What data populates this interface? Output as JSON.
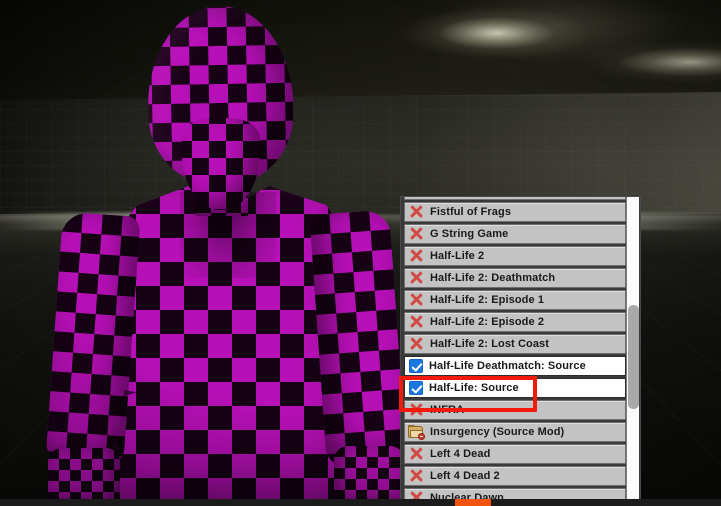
{
  "scene": {
    "description": "Source engine viewport showing a character model with missing textures (magenta/black checkerboard) in a dark room",
    "model_color_primary": "#b810b8",
    "model_color_secondary": "#170215",
    "room_color": "#2c2c26"
  },
  "list_panel": {
    "name": "mountable-games-list",
    "partial_top_row": true,
    "rows": [
      {
        "label": "Fistful of Frags",
        "status": "unavailable",
        "icon": "red-x-icon",
        "checked": false
      },
      {
        "label": "G String Game",
        "status": "unavailable",
        "icon": "red-x-icon",
        "checked": false
      },
      {
        "label": "Half-Life 2",
        "status": "unavailable",
        "icon": "red-x-icon",
        "checked": false
      },
      {
        "label": "Half-Life 2: Deathmatch",
        "status": "unavailable",
        "icon": "red-x-icon",
        "checked": false
      },
      {
        "label": "Half-Life 2: Episode 1",
        "status": "unavailable",
        "icon": "red-x-icon",
        "checked": false
      },
      {
        "label": "Half-Life 2: Episode 2",
        "status": "unavailable",
        "icon": "red-x-icon",
        "checked": false
      },
      {
        "label": "Half-Life 2: Lost Coast",
        "status": "unavailable",
        "icon": "red-x-icon",
        "checked": false
      },
      {
        "label": "Half-Life Deathmatch: Source",
        "status": "mounted",
        "icon": "blue-checkbox-icon",
        "checked": true
      },
      {
        "label": "Half-Life: Source",
        "status": "mounted",
        "icon": "blue-checkbox-icon",
        "checked": true
      },
      {
        "label": "INFRA",
        "status": "unavailable",
        "icon": "red-x-icon",
        "checked": false
      },
      {
        "label": "Insurgency (Source Mod)",
        "status": "folder",
        "icon": "folder-icon",
        "checked": false
      },
      {
        "label": "Left 4 Dead",
        "status": "unavailable",
        "icon": "red-x-icon",
        "checked": false
      },
      {
        "label": "Left 4 Dead 2",
        "status": "unavailable",
        "icon": "red-x-icon",
        "checked": false
      },
      {
        "label": "Nuclear Dawn",
        "status": "unavailable",
        "icon": "red-x-icon",
        "checked": false
      }
    ],
    "scrollbar": {
      "position_percent": 35,
      "thumb_size_percent": 33
    }
  },
  "annotation": {
    "name": "red-highlight-box",
    "color": "#f01b0d",
    "targets_row_label": "Half-Life: Source"
  },
  "taskbar": {
    "accent_color": "#f1540e"
  }
}
